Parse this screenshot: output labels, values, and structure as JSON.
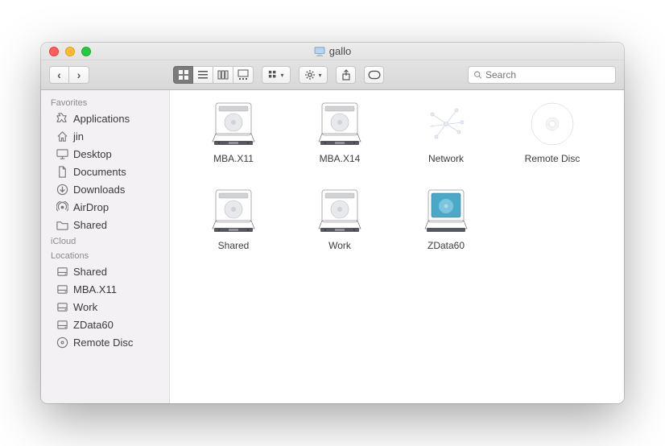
{
  "window": {
    "title": "gallo"
  },
  "search": {
    "placeholder": "Search"
  },
  "sidebar": {
    "sections": [
      {
        "label": "Favorites",
        "items": [
          {
            "label": "Applications",
            "icon": "applications"
          },
          {
            "label": "jin",
            "icon": "home"
          },
          {
            "label": "Desktop",
            "icon": "desktop"
          },
          {
            "label": "Documents",
            "icon": "documents"
          },
          {
            "label": "Downloads",
            "icon": "downloads"
          },
          {
            "label": "AirDrop",
            "icon": "airdrop"
          },
          {
            "label": "Shared",
            "icon": "folder"
          }
        ]
      },
      {
        "label": "iCloud",
        "items": []
      },
      {
        "label": "Locations",
        "items": [
          {
            "label": "Shared",
            "icon": "disk"
          },
          {
            "label": "MBA.X11",
            "icon": "disk"
          },
          {
            "label": "Work",
            "icon": "disk"
          },
          {
            "label": "ZData60",
            "icon": "disk"
          },
          {
            "label": "Remote Disc",
            "icon": "cd"
          }
        ]
      }
    ]
  },
  "items": [
    {
      "label": "MBA.X11",
      "icon": "hdd"
    },
    {
      "label": "MBA.X14",
      "icon": "hdd"
    },
    {
      "label": "Network",
      "icon": "network"
    },
    {
      "label": "Remote Disc",
      "icon": "cd-big"
    },
    {
      "label": "Shared",
      "icon": "hdd"
    },
    {
      "label": "Work",
      "icon": "hdd"
    },
    {
      "label": "ZData60",
      "icon": "hdd-int"
    }
  ]
}
